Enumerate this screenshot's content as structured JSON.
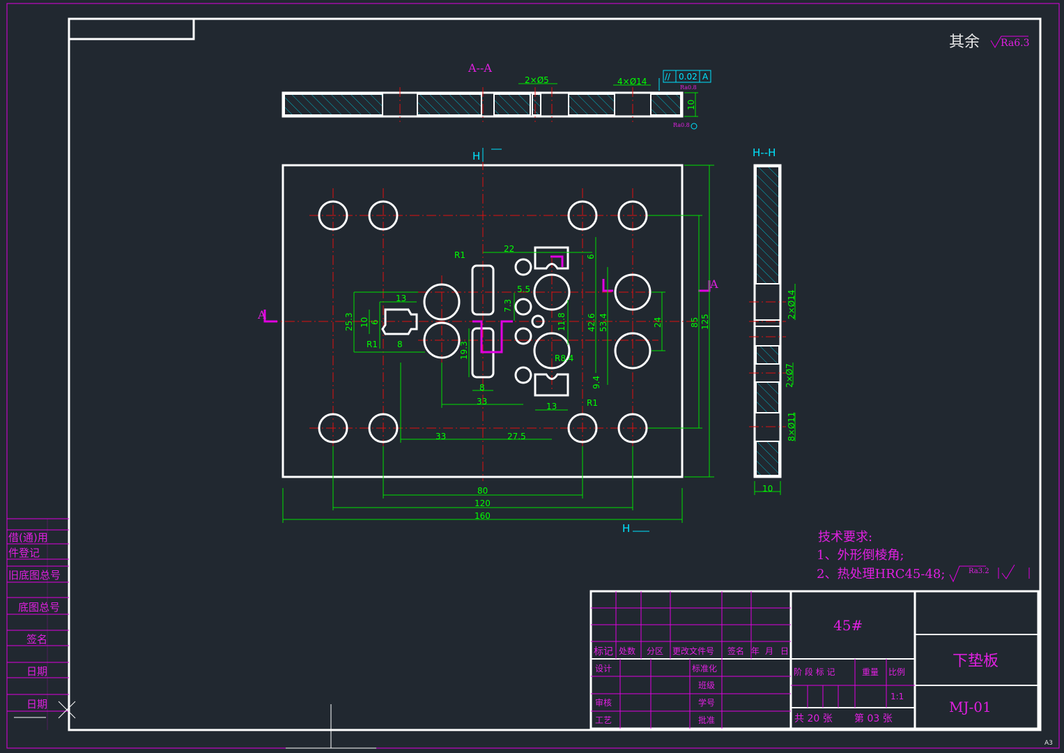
{
  "surface_note": {
    "label": "其余",
    "ra": "Ra6.3"
  },
  "views": {
    "section_aa": "A--A",
    "section_hh": "H--H",
    "cut_h_top": "H",
    "cut_h_bottom": "H",
    "cut_a_left": "A",
    "cut_a_right": "A"
  },
  "section_aa_dims": {
    "holes_small": "2×Ø5",
    "holes_large": "4×Ø14",
    "tolerance_symbol": "//",
    "tolerance_value": "0.02",
    "datum": "A",
    "ra_top": "Ra0.8",
    "ra_bottom": "Ra0.8",
    "thickness": "10"
  },
  "plan_dims": {
    "d22": "22",
    "d6": "6",
    "d13a": "13",
    "d10": "10",
    "d6b": "6",
    "d25_3": "25.3",
    "r1a": "R1",
    "r1b": "R1",
    "r1c": "R1",
    "d8a": "8",
    "d5_5": "5.5",
    "d7_3": "7.3",
    "d11_8": "11.8",
    "d42_6": "42.6",
    "d53_4": "53.4",
    "d24": "24",
    "d85": "85",
    "d125": "125",
    "d19_3": "19.3",
    "r8_4": "R8.4",
    "d9_4": "9.4",
    "d8b": "8",
    "d33a": "33",
    "d13b": "13",
    "d33b": "33",
    "d27_5": "27.5",
    "d80": "80",
    "d120": "120",
    "d160": "160"
  },
  "section_hh_dims": {
    "h1": "2×Ø14",
    "h2": "2×Ø7",
    "h3": "8×Ø11",
    "width": "10"
  },
  "tech_requirements": {
    "title": "技术要求:",
    "item1": "1、外形倒棱角;",
    "item2": "2、热处理HRC45-48;",
    "ra": "Ra3.2"
  },
  "left_strip": {
    "row1": "借(通)用",
    "row2": "件登记",
    "row3": "旧底图总号",
    "row4": "底图总号",
    "row5": "签名",
    "row6": "日期",
    "row7": "日期"
  },
  "title_block": {
    "material": "45#",
    "part_name": "下垫板",
    "drawing_no": "MJ-01",
    "hdr_mark": "标记",
    "hdr_count": "处数",
    "hdr_zone": "分区",
    "hdr_docno": "更改文件号",
    "hdr_sign": "签名",
    "hdr_year": "年",
    "hdr_month": "月",
    "hdr_day": "日",
    "design": "设计",
    "standard": "标准化",
    "class": "班级",
    "review": "审核",
    "student_no": "学号",
    "process": "工艺",
    "approve": "批准",
    "stage": "阶 段 标 记",
    "weight": "重量",
    "scale_label": "比例",
    "scale": "1:1",
    "sheets_total": "共 20 张",
    "sheet_no": "第 03 张"
  },
  "sheet_size": "A3"
}
